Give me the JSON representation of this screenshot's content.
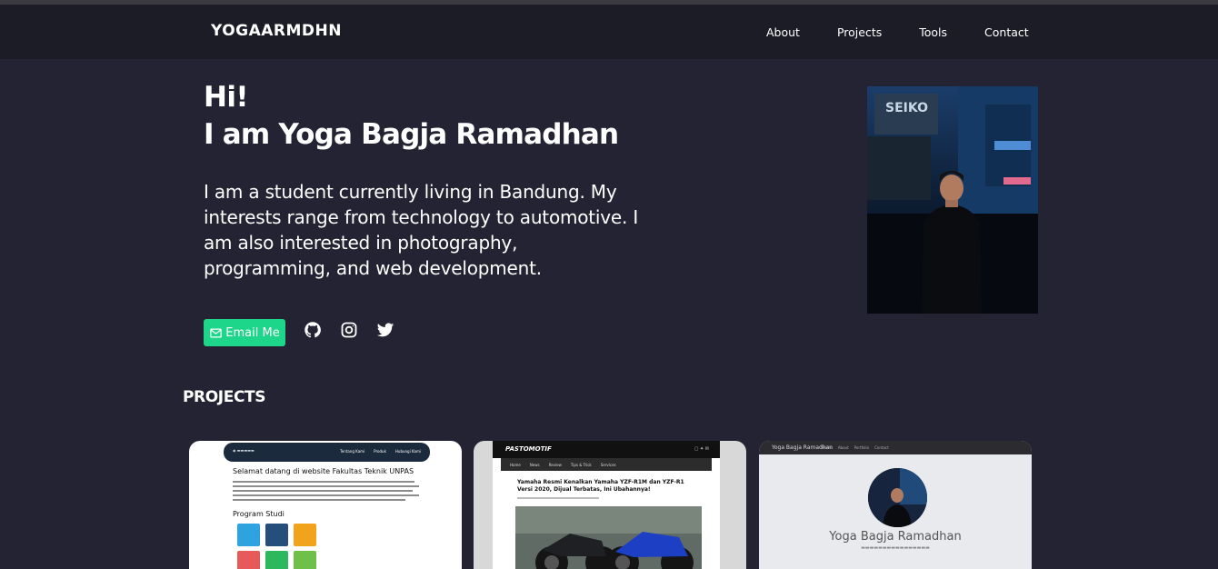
{
  "nav": {
    "brand": "YOGAARMDHN",
    "links": [
      "About",
      "Projects",
      "Tools",
      "Contact"
    ]
  },
  "hero": {
    "greeting": "Hi!",
    "name": "I am Yoga Bagja Ramadhan",
    "bio": "I am a student currently living in Bandung. My interests range from technology to automotive. I am also interested in photography, programming, and web development.",
    "email_button": "Email Me",
    "email_icon": "mail-icon",
    "socials": [
      "github-icon",
      "instagram-icon",
      "twitter-icon"
    ]
  },
  "photo": {
    "sign_text": "SEIKO"
  },
  "projects": {
    "title": "PROJECTS",
    "card1": {
      "nav_links": [
        "Tentang Kami",
        "Produk",
        "Hubungi Kami"
      ],
      "heading": "Selamat datang di website Fakultas Teknik UNPAS",
      "subheading": "Program Studi"
    },
    "card2": {
      "logo": "PASTOMOTIF",
      "menu": [
        "Home",
        "News",
        "Review",
        "Tips & Trick",
        "Services"
      ],
      "headline": "Yamaha Resmi Kenalkan Yamaha YZF-R1M dan YZF-R1 Versi 2020, Dijual Terbatas, Ini Ubahannya!"
    },
    "card3": {
      "bar_brand": "Yoga Bagja Ramadhan",
      "bar_links": [
        "Home",
        "About",
        "Portfolio",
        "Contact"
      ],
      "name": "Yoga Bagja Ramadhan"
    }
  },
  "colors": {
    "background": "#232333",
    "navbar": "#1c1c26",
    "accent": "#1ed689"
  }
}
